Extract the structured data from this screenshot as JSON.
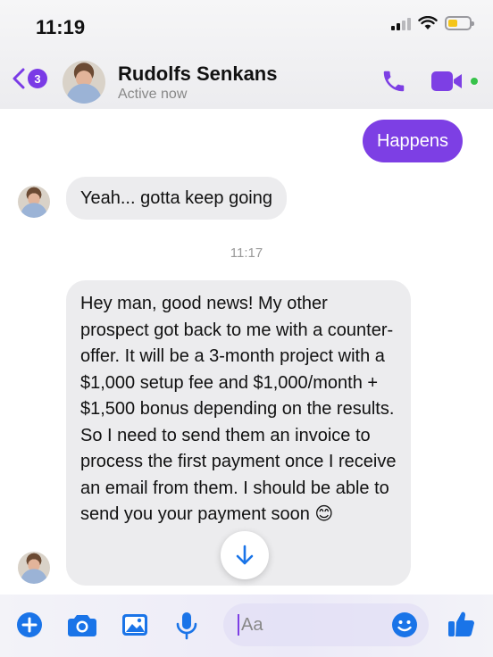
{
  "status_bar": {
    "time": "11:19"
  },
  "header": {
    "back_count": "3",
    "contact_name": "Rudolfs Senkans",
    "contact_status": "Active now"
  },
  "messages": {
    "outgoing_1": "Happens",
    "incoming_1": "Yeah... gotta keep going",
    "timestamp": "11:17",
    "incoming_2": "Hey man, good news! My other prospect got back to me with a counter-offer. It will be a 3-month project with a $1,000 setup fee and $1,000/month + $1,500 bonus depending on the results. So I need to send them an invoice to process the first payment once I receive an email from them. I should be able to send you your payment soon 😊"
  },
  "composer": {
    "placeholder": "Aa"
  },
  "colors": {
    "accent": "#7d3fe4",
    "online": "#37c24a",
    "icon_blue": "#1a74e8"
  },
  "icons": [
    "back-chevron-icon",
    "phone-icon",
    "video-camera-icon",
    "arrow-down-icon",
    "plus-icon",
    "camera-icon",
    "image-icon",
    "microphone-icon",
    "emoji-icon",
    "thumbs-up-icon"
  ]
}
